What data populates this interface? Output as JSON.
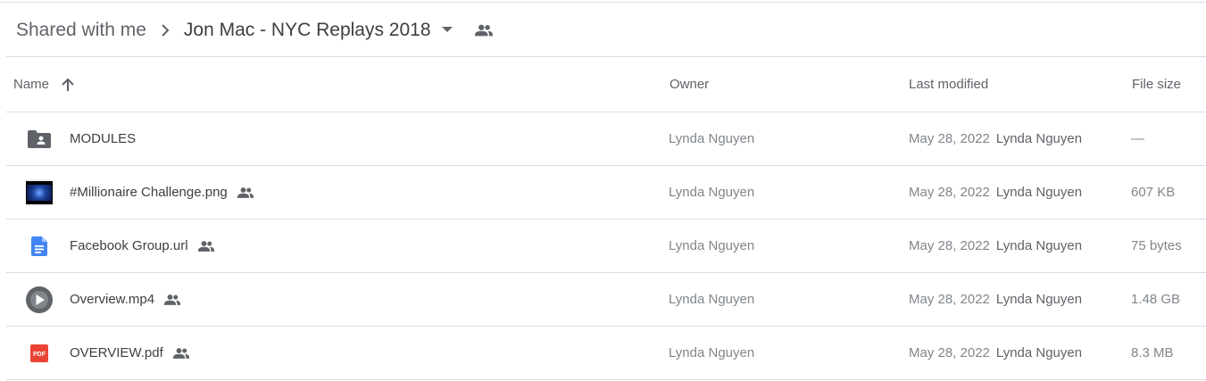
{
  "breadcrumb": {
    "root": "Shared with me",
    "current": "Jon Mac - NYC Replays 2018"
  },
  "columns": {
    "name": "Name",
    "owner": "Owner",
    "last_modified": "Last modified",
    "file_size": "File size"
  },
  "files": [
    {
      "name": "MODULES",
      "icon": "shared-folder-icon",
      "shared": false,
      "owner": "Lynda Nguyen",
      "date": "May 28, 2022",
      "modified_by": "Lynda Nguyen",
      "size": "—"
    },
    {
      "name": "#Millionaire Challenge.png",
      "icon": "image-thumbnail",
      "shared": true,
      "owner": "Lynda Nguyen",
      "date": "May 28, 2022",
      "modified_by": "Lynda Nguyen",
      "size": "607 KB"
    },
    {
      "name": "Facebook Group.url",
      "icon": "doc-icon",
      "shared": true,
      "owner": "Lynda Nguyen",
      "date": "May 28, 2022",
      "modified_by": "Lynda Nguyen",
      "size": "75 bytes"
    },
    {
      "name": "Overview.mp4",
      "icon": "video-icon",
      "shared": true,
      "owner": "Lynda Nguyen",
      "date": "May 28, 2022",
      "modified_by": "Lynda Nguyen",
      "size": "1.48 GB"
    },
    {
      "name": "OVERVIEW.pdf",
      "icon": "pdf-icon",
      "shared": true,
      "owner": "Lynda Nguyen",
      "date": "May 28, 2022",
      "modified_by": "Lynda Nguyen",
      "size": "8.3 MB"
    }
  ],
  "colors": {
    "doc_blue": "#4285f4",
    "pdf_red": "#ea4335",
    "icon_gray": "#5f6368"
  }
}
